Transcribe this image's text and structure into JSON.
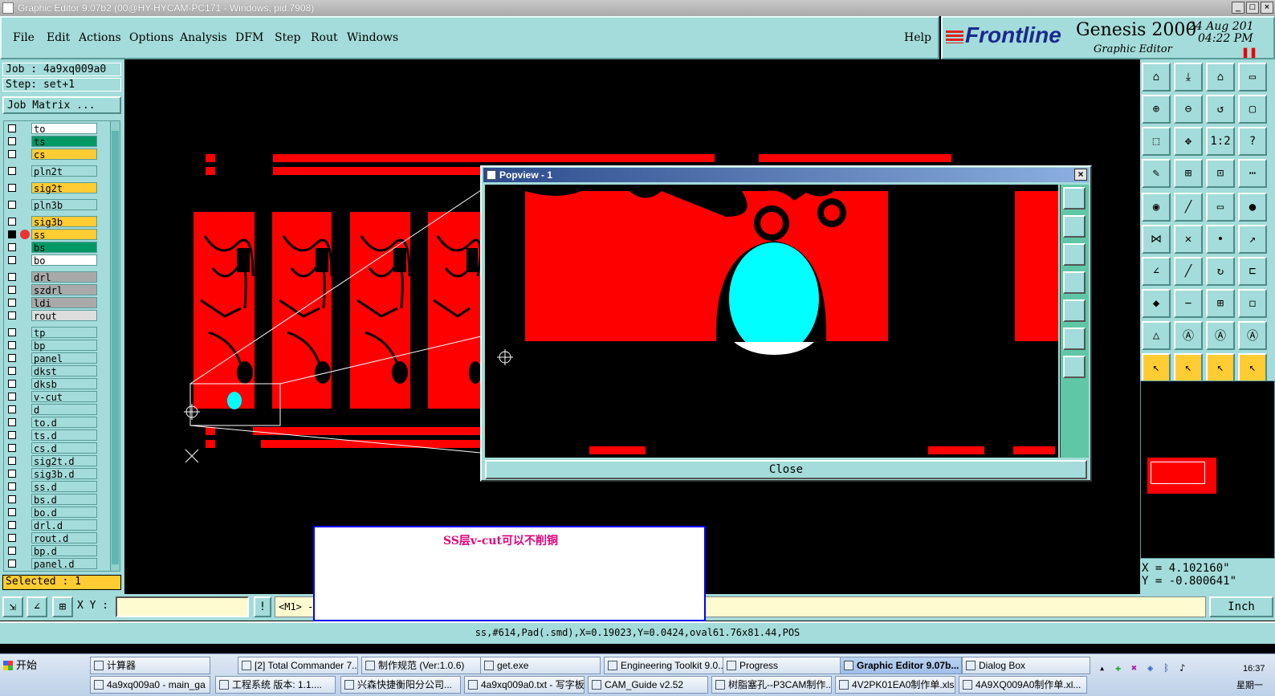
{
  "window": {
    "title": "Graphic Editor 9.07b2 (00@HY-HYCAM-PC171 - Windows, pid:7908)"
  },
  "menu": {
    "items": [
      "File",
      "Edit",
      "Actions",
      "Options",
      "Analysis",
      "DFM",
      "Step",
      "Rout",
      "Windows"
    ],
    "help": "Help"
  },
  "brand": {
    "logo": "Frontline",
    "product": "Genesis 2000",
    "subtitle": "Graphic Editor",
    "date": "24 Aug 201",
    "time": "04:22 PM"
  },
  "job": {
    "job": "Job : 4a9xq009a0",
    "step": "Step: set+1",
    "matrix_button": "Job Matrix ..."
  },
  "layers": [
    {
      "name": "to",
      "color": "#ffffff"
    },
    {
      "name": "ts",
      "color": "#009966"
    },
    {
      "name": "cs",
      "color": "#ffcc33"
    },
    {
      "name": "pln2t",
      "color": "#a3dcda"
    },
    {
      "name": "sig2t",
      "color": "#ffcc33"
    },
    {
      "name": "pln3b",
      "color": "#a3dcda"
    },
    {
      "name": "sig3b",
      "color": "#ffcc33"
    },
    {
      "name": "ss",
      "color": "#ffcc33"
    },
    {
      "name": "bs",
      "color": "#009966"
    },
    {
      "name": "bo",
      "color": "#ffffff"
    },
    {
      "name": "drl",
      "color": "#a9a9a9"
    },
    {
      "name": "szdrl",
      "color": "#a9a9a9"
    },
    {
      "name": "ldi",
      "color": "#a9a9a9"
    },
    {
      "name": "rout",
      "color": "#dddddd"
    },
    {
      "name": "tp",
      "color": "#a3dcda"
    },
    {
      "name": "bp",
      "color": "#a3dcda"
    },
    {
      "name": "panel",
      "color": "#a3dcda"
    },
    {
      "name": "dkst",
      "color": "#a3dcda"
    },
    {
      "name": "dksb",
      "color": "#a3dcda"
    },
    {
      "name": "v-cut",
      "color": "#a3dcda"
    },
    {
      "name": "d",
      "color": "#a3dcda"
    },
    {
      "name": "to.d",
      "color": "#a3dcda"
    },
    {
      "name": "ts.d",
      "color": "#a3dcda"
    },
    {
      "name": "cs.d",
      "color": "#a3dcda"
    },
    {
      "name": "sig2t.d",
      "color": "#a3dcda"
    },
    {
      "name": "sig3b.d",
      "color": "#a3dcda"
    },
    {
      "name": "ss.d",
      "color": "#a3dcda"
    },
    {
      "name": "bs.d",
      "color": "#a3dcda"
    },
    {
      "name": "bo.d",
      "color": "#a3dcda"
    },
    {
      "name": "drl.d",
      "color": "#a3dcda"
    },
    {
      "name": "rout.d",
      "color": "#a3dcda"
    },
    {
      "name": "bp.d",
      "color": "#a3dcda"
    },
    {
      "name": "panel.d",
      "color": "#a3dcda"
    }
  ],
  "selected": "Selected : 1",
  "popview": {
    "title": "Popview - 1",
    "close": "Close"
  },
  "coords": {
    "x": "X = 4.102160\"",
    "y": "Y = -0.800641\""
  },
  "bottom": {
    "xy_label": "X Y :",
    "xy_value": "",
    "m1": "<M1> -",
    "units": "Inch"
  },
  "status": "ss,#614,Pad(.smd),X=0.19023,Y=0.0424,oval61.76x81.44,POS",
  "note": "SS层v-cut可以不削铜",
  "taskbar": {
    "start": "开始",
    "row1": [
      "计算器",
      "[2] Total Commander 7...",
      "制作规范 (Ver:1.0.6)",
      "get.exe",
      "Engineering Toolkit 9.0...",
      "Progress",
      "Graphic Editor 9.07b...",
      "Dialog Box"
    ],
    "row2": [
      "4a9xq009a0 - main_ga",
      "工程系统  版本: 1.1....",
      "兴森快捷衡阳分公司...",
      "4a9xq009a0.txt - 写字板",
      "CAM_Guide v2.52",
      "树脂塞孔--P3CAM制作...",
      "4V2PK01EA0制作单.xls...",
      "4A9XQ009A0制作单.xl..."
    ],
    "clock": "16:37",
    "day": "星期一"
  },
  "colors": {
    "panel": "#a3dcda",
    "copper": "#ff0000",
    "pad": "#00ffff",
    "layer_active": "#ffcc33"
  }
}
